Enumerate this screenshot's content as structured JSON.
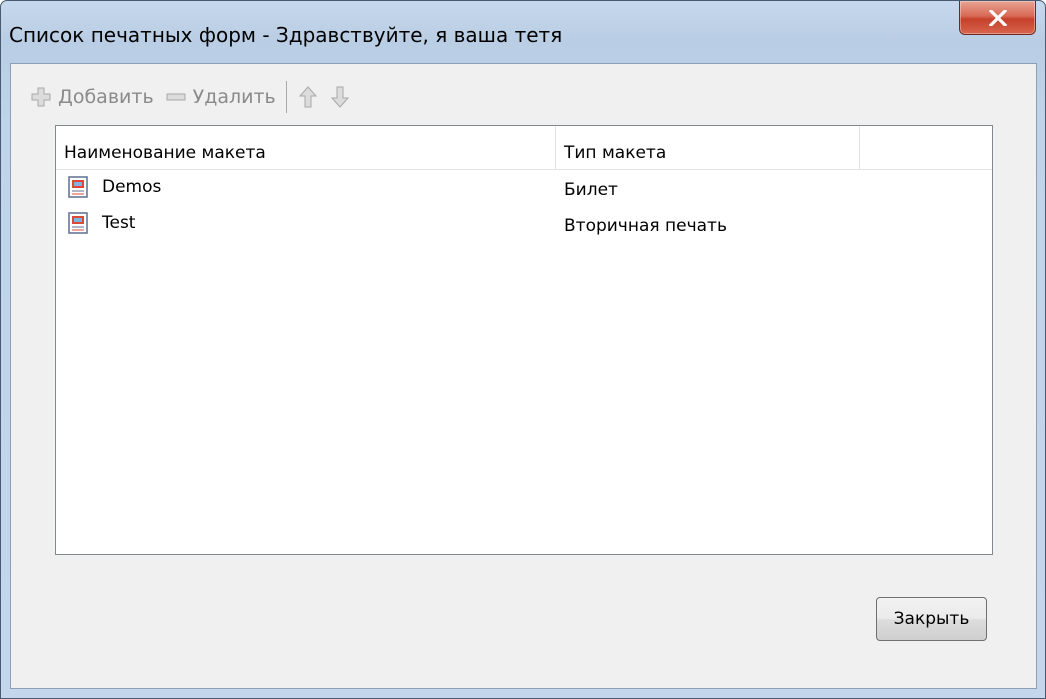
{
  "window": {
    "title": "Список печатных форм - Здравствуйте, я ваша тетя",
    "close_icon": "close-x-icon"
  },
  "toolbar": {
    "add_label": "Добавить",
    "delete_label": "Удалить",
    "icons": [
      "plus-icon",
      "minus-icon",
      "arrow-up-icon",
      "arrow-down-icon"
    ]
  },
  "list": {
    "columns": [
      "Наименование макета",
      "Тип макета",
      ""
    ],
    "rows": [
      {
        "name": "Demos",
        "type": "Билет",
        "icon": "document-icon"
      },
      {
        "name": "Test",
        "type": "Вторичная печать",
        "icon": "document-icon"
      }
    ]
  },
  "footer": {
    "close_label": "Закрыть"
  },
  "colors": {
    "window_frame": "#bfd3ea",
    "client_bg": "#f0f0f0",
    "close_button_red": "#c5412b",
    "disabled_text": "#8a8a8a"
  }
}
